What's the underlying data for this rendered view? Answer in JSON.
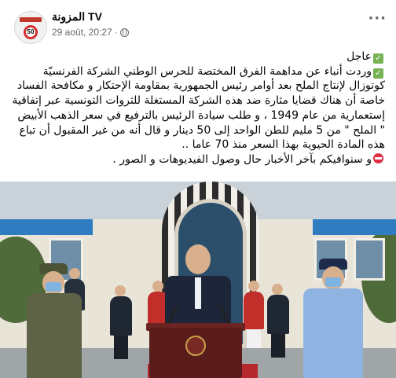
{
  "post": {
    "page_name": "المزونة TV",
    "timestamp": "29 août, 20:27",
    "visibility_separator": "·",
    "more_label": "···",
    "avatar": {
      "logo_text": "50",
      "strip_color": "#c0392b",
      "ring_color": "#d32f2f"
    },
    "icons": {
      "visibility": "globe-icon",
      "menu": "more-horizontal-icon",
      "check": "white-check-mark-emoji",
      "stop": "no-entry-emoji"
    },
    "text": {
      "line1": "عاجل",
      "paragraph": "وردت أنباء عن مداهمة الفرق المختصة للحرس الوطني الشركة الفرنسيّة كوتوزال لإنتاج الملح  بعد أوامر رئيس الجمهورية بمقاومة الإحتكار و مكافحة الفساد خاصة أن هناك قضايا مثارة ضد هذه الشركة المستغلة للثروات التونسية عبر إتفاقية إستعمارية من عام 1949 ، و طلب سيادة الرئيس بالترفيع في سعر الذهب الأبيض \" الملح \" من 5 مليم للطن الواحد إلى 50 دينار و قال أنه من غير المقبول أن تباع هذه المادة الحيوية بهذا السعر منذ 70 عاما  ..",
      "last": "و سنوافيكم بآخر الأخبار حال وصول الفيديوهات و الصور ."
    },
    "photo": {
      "description_icon": "press-conference-photo"
    }
  },
  "colors": {
    "name": "#050505",
    "meta": "#65676b",
    "check_emoji": "#77b255",
    "stop_emoji": "#dd2e44"
  }
}
